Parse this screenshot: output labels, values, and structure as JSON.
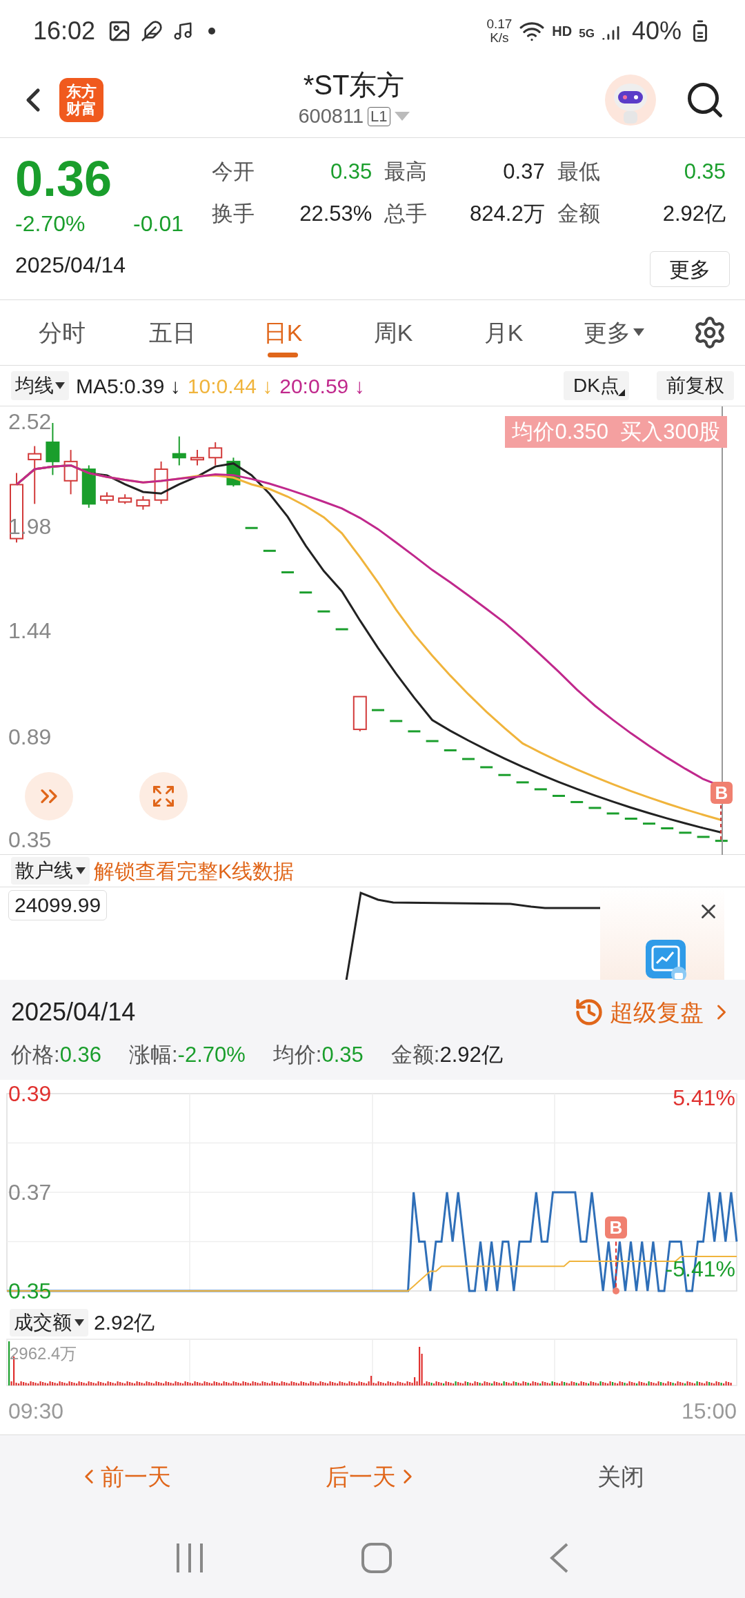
{
  "status_bar": {
    "time": "16:02",
    "net_speed": "0.17",
    "net_unit": "K/s",
    "hd": "HD",
    "network": "5G",
    "battery": "40%"
  },
  "header": {
    "logo": [
      "东方",
      "财富"
    ],
    "title": "*ST东方",
    "code": "600811",
    "level_badge": "L1"
  },
  "quote": {
    "price": "0.36",
    "color": "#1a9e2c",
    "change_pct": "-2.70%",
    "change": "-0.01",
    "date": "2025/04/14",
    "more_button": "更多",
    "stats": [
      {
        "label": "今开",
        "value": "0.35",
        "color": "#1a9e2c"
      },
      {
        "label": "最高",
        "value": "0.37",
        "color": "#222222"
      },
      {
        "label": "最低",
        "value": "0.35",
        "color": "#1a9e2c"
      },
      {
        "label": "换手",
        "value": "22.53%",
        "color": "#222222"
      },
      {
        "label": "总手",
        "value": "824.2万",
        "color": "#222222"
      },
      {
        "label": "金额",
        "value": "2.92亿",
        "color": "#222222"
      }
    ]
  },
  "tabs": [
    {
      "label": "分时",
      "selected": false
    },
    {
      "label": "五日",
      "selected": false
    },
    {
      "label": "日K",
      "selected": true
    },
    {
      "label": "周K",
      "selected": false
    },
    {
      "label": "月K",
      "selected": false
    },
    {
      "label": "更多",
      "selected": false,
      "dropdown": true
    }
  ],
  "indicator_bar": {
    "selector": "均线",
    "dk_button": "DK点",
    "adjust_button": "前复权",
    "ma": [
      {
        "text": "MA5:0.39",
        "arrow": "↓",
        "color": "#222222"
      },
      {
        "text": "10:0.44",
        "arrow": "↓",
        "color": "#f0b43c"
      },
      {
        "text": "20:0.59",
        "arrow": "↓",
        "color": "#c0288c"
      }
    ]
  },
  "kline": {
    "y_labels": [
      "2.52",
      "1.98",
      "1.44",
      "0.89",
      "0.35"
    ],
    "trade_tag": "均价0.350  买入300股",
    "buy_marker": "B"
  },
  "sub_indicator": {
    "selector": "散户线",
    "unlock_link": "解锁查看完整K线数据",
    "value_tag": "24099.99"
  },
  "detail": {
    "date": "2025/04/14",
    "replay_link": "超级复盘",
    "stats": [
      {
        "label": "价格:",
        "value": "0.36",
        "color": "#1a9e2c"
      },
      {
        "label": "涨幅:",
        "value": "-2.70%",
        "color": "#1a9e2c"
      },
      {
        "label": "均价:",
        "value": "0.35",
        "color": "#1a9e2c"
      },
      {
        "label": "金额:",
        "value": "2.92亿",
        "color": "#222222"
      }
    ],
    "pct_labels": [
      {
        "text": "5.41%",
        "color": "#e0312f"
      },
      {
        "text": "-5.41%",
        "color": "#1a9e2c"
      }
    ],
    "chart_data": {
      "type": "line",
      "ylim": [
        0.35,
        0.39
      ],
      "yticks": [
        {
          "value": 0.39,
          "label": "0.39"
        },
        {
          "value": 0.37,
          "label": "0.37"
        },
        {
          "value": 0.35,
          "label": "0.35"
        }
      ],
      "series": [
        {
          "color": "#2f6fb8",
          "values": [
            0.35,
            0.35,
            0.35,
            0.35,
            0.35,
            0.35,
            0.35,
            0.35,
            0.35,
            0.35,
            0.35,
            0.35,
            0.35,
            0.35,
            0.35,
            0.35,
            0.35,
            0.35,
            0.35,
            0.35,
            0.35,
            0.35,
            0.35,
            0.35,
            0.35,
            0.35,
            0.35,
            0.35,
            0.35,
            0.35,
            0.35,
            0.35,
            0.35,
            0.35,
            0.35,
            0.35,
            0.35,
            0.35,
            0.35,
            0.35,
            0.35,
            0.35,
            0.35,
            0.35,
            0.35,
            0.35,
            0.35,
            0.35,
            0.35,
            0.35,
            0.35,
            0.35,
            0.35,
            0.35,
            0.35,
            0.35,
            0.35,
            0.35,
            0.35,
            0.35,
            0.35,
            0.35,
            0.35,
            0.35,
            0.35,
            0.35,
            0.35,
            0.35,
            0.35,
            0.35,
            0.35,
            0.35,
            0.35,
            0.37,
            0.36,
            0.36,
            0.35,
            0.36,
            0.36,
            0.37,
            0.36,
            0.37,
            0.36,
            0.35,
            0.35,
            0.36,
            0.35,
            0.36,
            0.35,
            0.36,
            0.36,
            0.35,
            0.36,
            0.36,
            0.36,
            0.37,
            0.36,
            0.36,
            0.37,
            0.37,
            0.37,
            0.37,
            0.37,
            0.36,
            0.36,
            0.37,
            0.36,
            0.35,
            0.36,
            0.35,
            0.36,
            0.35,
            0.36,
            0.35,
            0.36,
            0.35,
            0.36,
            0.35,
            0.35,
            0.36,
            0.36,
            0.36,
            0.35,
            0.35,
            0.36,
            0.36,
            0.37,
            0.36,
            0.37,
            0.36,
            0.37,
            0.36
          ]
        },
        {
          "color": "#f0b43c",
          "values": [
            0.35,
            0.35,
            0.35,
            0.35,
            0.35,
            0.35,
            0.35,
            0.35,
            0.35,
            0.35,
            0.35,
            0.35,
            0.35,
            0.35,
            0.35,
            0.35,
            0.35,
            0.35,
            0.35,
            0.35,
            0.35,
            0.35,
            0.35,
            0.35,
            0.35,
            0.35,
            0.35,
            0.35,
            0.35,
            0.35,
            0.35,
            0.35,
            0.35,
            0.35,
            0.35,
            0.35,
            0.35,
            0.35,
            0.35,
            0.35,
            0.35,
            0.35,
            0.35,
            0.35,
            0.35,
            0.35,
            0.35,
            0.35,
            0.35,
            0.35,
            0.35,
            0.35,
            0.35,
            0.35,
            0.35,
            0.35,
            0.35,
            0.35,
            0.35,
            0.35,
            0.35,
            0.35,
            0.35,
            0.35,
            0.35,
            0.35,
            0.35,
            0.35,
            0.35,
            0.35,
            0.35,
            0.35,
            0.35,
            0.351,
            0.352,
            0.353,
            0.354,
            0.354,
            0.355,
            0.355,
            0.355,
            0.355,
            0.355,
            0.355,
            0.355,
            0.355,
            0.355,
            0.355,
            0.355,
            0.355,
            0.355,
            0.355,
            0.355,
            0.355,
            0.355,
            0.355,
            0.355,
            0.355,
            0.355,
            0.355,
            0.355,
            0.356,
            0.356,
            0.356,
            0.356,
            0.356,
            0.356,
            0.356,
            0.356,
            0.356,
            0.356,
            0.356,
            0.356,
            0.356,
            0.356,
            0.356,
            0.356,
            0.356,
            0.356,
            0.356,
            0.356,
            0.357,
            0.357,
            0.357,
            0.357,
            0.357,
            0.357,
            0.357,
            0.357,
            0.357,
            0.357,
            0.357
          ]
        }
      ]
    },
    "buy_marker": "B",
    "volume_selector": "成交额",
    "volume_total": "2.92亿",
    "volume_max": "2962.4万",
    "time_start": "09:30",
    "time_end": "15:00"
  },
  "footer": {
    "prev_button": "前一天",
    "next_button": "后一天",
    "close_button": "关闭"
  }
}
